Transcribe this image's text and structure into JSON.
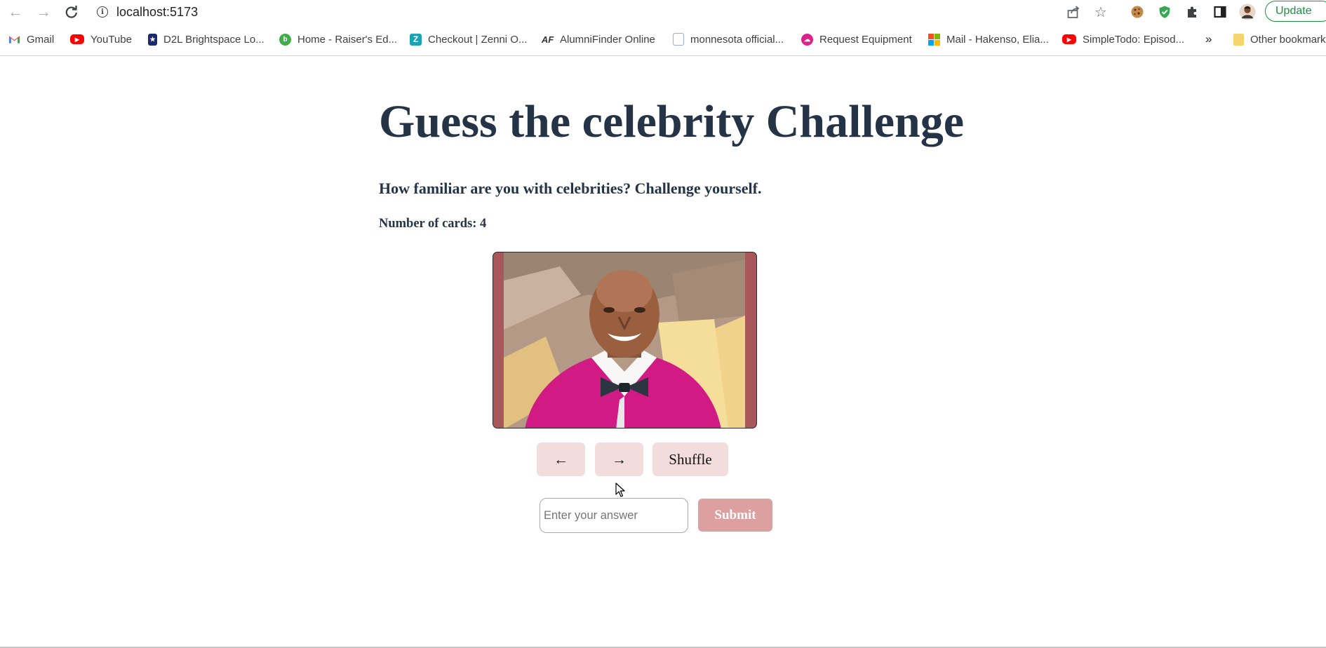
{
  "browser": {
    "url": "localhost:5173",
    "update_label": "Update",
    "bookmarks": [
      {
        "label": "Gmail",
        "icon": "gmail-icon",
        "color": "#ea4335"
      },
      {
        "label": "YouTube",
        "icon": "youtube-icon",
        "color": "#ff0000"
      },
      {
        "label": "D2L Brightspace Lo...",
        "icon": "d2l-icon",
        "color": "#1a2a6c"
      },
      {
        "label": "Home - Raiser's Ed...",
        "icon": "raisers-edge-icon",
        "color": "#3fae49"
      },
      {
        "label": "Checkout | Zenni O...",
        "icon": "zenni-icon",
        "color": "#1aa3b5"
      },
      {
        "label": "AlumniFinder Online",
        "icon": "alumnifinder-icon",
        "color": "#333333"
      },
      {
        "label": "monnesota official...",
        "icon": "doc-icon",
        "color": "#5b7fbf"
      },
      {
        "label": "Request Equipment",
        "icon": "cloud-icon",
        "color": "#e0218a"
      },
      {
        "label": "Mail - Hakenso, Elia...",
        "icon": "microsoft-icon",
        "color": "#f25022"
      },
      {
        "label": "SimpleTodo: Episod...",
        "icon": "youtube-icon",
        "color": "#ff0000"
      }
    ],
    "overflow_label": "»",
    "other_bookmarks": "Other bookmarks"
  },
  "page": {
    "title": "Guess the celebrity Challenge",
    "subtitle": "How familiar are you with celebrities? Challenge yourself.",
    "card_count": "Number of cards: 4",
    "prev_label": "←",
    "next_label": "→",
    "shuffle_label": "Shuffle",
    "answer_placeholder": "Enter your answer",
    "submit_label": "Submit"
  },
  "colors": {
    "heading": "#253347",
    "card_border": "#a8585a",
    "button_bg": "#f2dcdc",
    "submit_bg": "#dca0a0"
  }
}
